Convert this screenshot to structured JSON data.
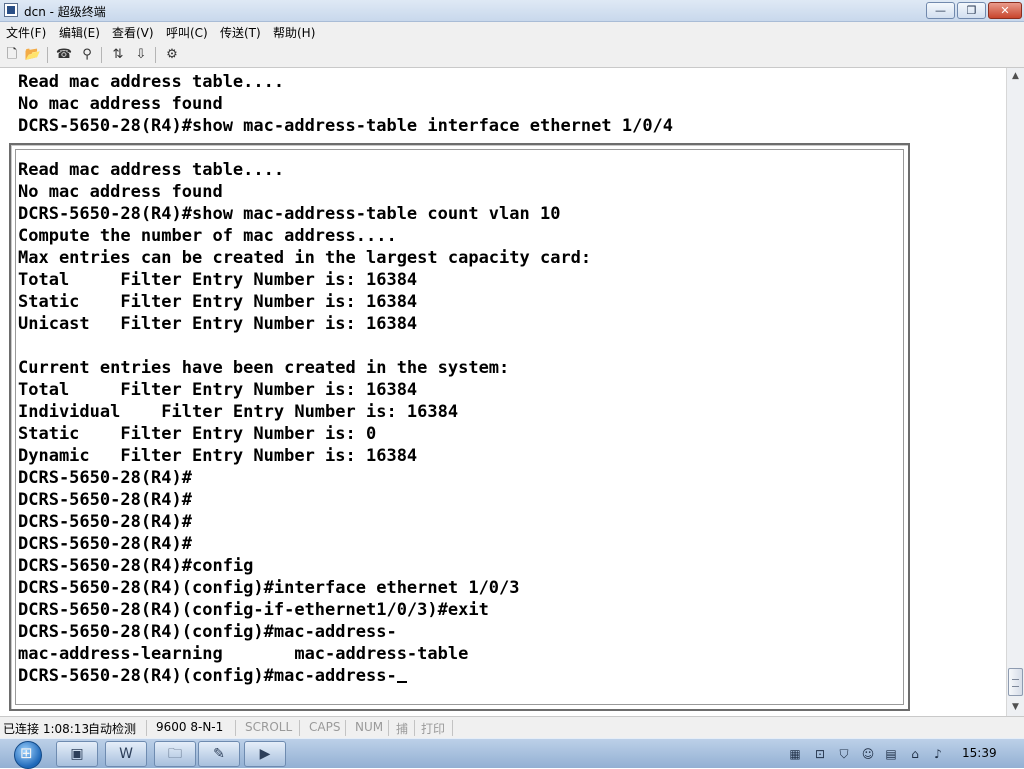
{
  "window": {
    "title": "dcn - 超级终端",
    "controls": {
      "minimize": "—",
      "maximize": "❐",
      "close": "✕"
    }
  },
  "menu": [
    {
      "label": "文件(F)"
    },
    {
      "label": "编辑(E)"
    },
    {
      "label": "查看(V)"
    },
    {
      "label": "呼叫(C)"
    },
    {
      "label": "传送(T)"
    },
    {
      "label": "帮助(H)"
    }
  ],
  "toolbar": {
    "icons": [
      "new-icon",
      "open-icon",
      "disconnect-icon",
      "dial-icon",
      "send-icon",
      "receive-icon",
      "properties-icon"
    ],
    "glyphs": [
      "🗋",
      "📂",
      "☎",
      "⚲",
      "⇅",
      "⇩",
      "⚙"
    ]
  },
  "terminal": {
    "background_lines": [
      "Read mac address table....",
      "No mac address found",
      "DCRS-5650-28(R4)#show mac-address-table interface ethernet 1/0/4"
    ],
    "lines": [
      "Read mac address table....",
      "No mac address found",
      "DCRS-5650-28(R4)#show mac-address-table count vlan 10",
      "Compute the number of mac address....",
      "Max entries can be created in the largest capacity card:",
      "Total     Filter Entry Number is: 16384",
      "Static    Filter Entry Number is: 16384",
      "Unicast   Filter Entry Number is: 16384",
      "",
      "Current entries have been created in the system:",
      "Total     Filter Entry Number is: 16384",
      "Individual    Filter Entry Number is: 16384",
      "Static    Filter Entry Number is: 0",
      "Dynamic   Filter Entry Number is: 16384",
      "DCRS-5650-28(R4)#",
      "DCRS-5650-28(R4)#",
      "DCRS-5650-28(R4)#",
      "DCRS-5650-28(R4)#",
      "DCRS-5650-28(R4)#config",
      "DCRS-5650-28(R4)(config)#interface ethernet 1/0/3",
      "DCRS-5650-28(R4)(config-if-ethernet1/0/3)#exit",
      "DCRS-5650-28(R4)(config)#mac-address-",
      "mac-address-learning       mac-address-table"
    ],
    "prompt_line": "DCRS-5650-28(R4)(config)#mac-address-"
  },
  "status": {
    "connection": "已连接 1:08:13",
    "detect": "自动检测",
    "port": "9600 8-N-1",
    "scroll": "SCROLL",
    "caps": "CAPS",
    "num": "NUM",
    "capture": "捕",
    "print": "打印"
  },
  "taskbar": {
    "apps": [
      {
        "name": "explorer-icon",
        "glyph": "▣"
      },
      {
        "name": "word-icon",
        "glyph": "W"
      },
      {
        "name": "folder-icon",
        "glyph": "🗀"
      },
      {
        "name": "paint-icon",
        "glyph": "✎"
      },
      {
        "name": "ppt-icon",
        "glyph": "▶"
      }
    ],
    "tray": [
      {
        "name": "network-meter-icon",
        "glyph": "▦"
      },
      {
        "name": "connection-icon",
        "glyph": "⊡"
      },
      {
        "name": "shield-icon",
        "glyph": "⛉"
      },
      {
        "name": "messenger-icon",
        "glyph": "☺"
      },
      {
        "name": "clipboard-icon",
        "glyph": "▤"
      },
      {
        "name": "network-icon",
        "glyph": "⌂"
      },
      {
        "name": "volume-icon",
        "glyph": "♪"
      }
    ],
    "clock": "15:39"
  }
}
